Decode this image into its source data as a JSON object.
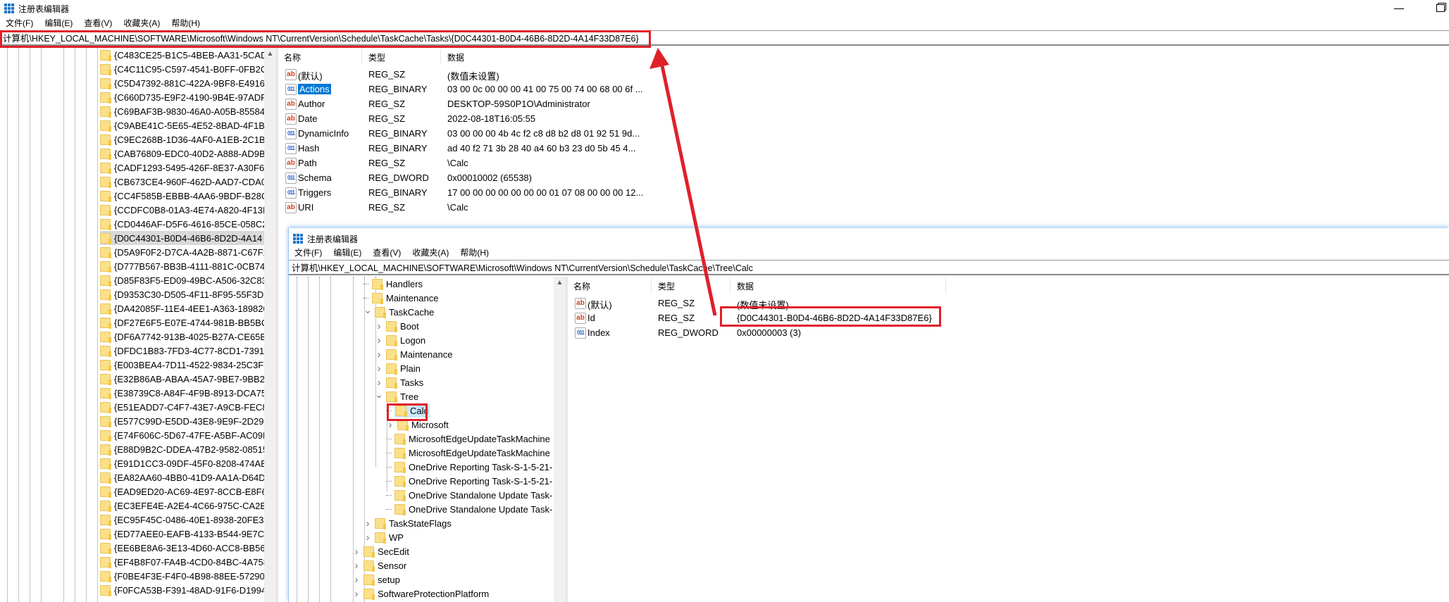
{
  "main_window": {
    "title": "注册表编辑器",
    "menu": [
      "文件(F)",
      "编辑(E)",
      "查看(V)",
      "收藏夹(A)",
      "帮助(H)"
    ],
    "address": "计算机\\HKEY_LOCAL_MACHINE\\SOFTWARE\\Microsoft\\Windows NT\\CurrentVersion\\Schedule\\TaskCache\\Tasks\\{D0C44301-B0D4-46B6-8D2D-4A14F33D87E6}",
    "tree_items": [
      "{C483CE25-B1C5-4BEB-AA31-5CAD",
      "{C4C11C95-C597-4541-B0FF-0FB2C7",
      "{C5D47392-881C-422A-9BF8-E4916",
      "{C660D735-E9F2-4190-9B4E-97ADF",
      "{C69BAF3B-9830-46A0-A05B-85584",
      "{C9ABE41C-5E65-4E52-8BAD-4F1BC",
      "{C9EC268B-1D36-4AF0-A1EB-2C1BC",
      "{CAB76809-EDC0-40D2-A888-AD9B",
      "{CADF1293-5495-426F-8E37-A30F69",
      "{CB673CE4-960F-462D-AAD7-CDA0",
      "{CC4F585B-EBBB-4AA6-9BDF-B28C",
      "{CCDFC0B8-01A3-4E74-A820-4F13F",
      "{CD0446AF-D5F6-4616-85CE-058C2",
      "{D0C44301-B0D4-46B6-8D2D-4A14",
      "{D5A9F0F2-D7CA-4A2B-8871-C67F2",
      "{D777B567-BB3B-4111-881C-0CB74",
      "{D85F83F5-ED09-49BC-A506-32C83",
      "{D9353C30-D505-4F11-8F95-55F3DI",
      "{DA42085F-11E4-4EE1-A363-189820",
      "{DF27E6F5-E07E-4744-981B-BB5BC",
      "{DF6A7742-913B-4025-B27A-CE65B",
      "{DFDC1B83-7FD3-4C77-8CD1-7391D",
      "{E003BEA4-7D11-4522-9834-25C3F",
      "{E32B86AB-ABAA-45A7-9BE7-9BB2I",
      "{E38739C8-A84F-4F9B-8913-DCA75",
      "{E51EADD7-C4F7-43E7-A9CB-FEC8E",
      "{E577C99D-E5DD-43E8-9E9F-2D291",
      "{E74F606C-5D67-47FE-A5BF-AC09E",
      "{E88D9B2C-DDEA-47B2-9582-08515",
      "{E91D1CC3-09DF-45F0-8208-474AE",
      "{EA82AA60-4BB0-41D9-AA1A-D64D",
      "{EAD9ED20-AC69-4E97-8CCB-E8F62",
      "{EC3EFE4E-A2E4-4C66-975C-CA2EFI",
      "{EC95F45C-0486-40E1-8938-20FE3E",
      "{ED77AEE0-EAFB-4133-B544-9E7C5",
      "{EE6BE8A6-3E13-4D60-ACC8-BB56D",
      "{EF4B8F07-FA4B-4CD0-84BC-4A758",
      "{F0BE4F3E-F4F0-4B98-88EE-57290D",
      "{F0FCA53B-F391-48AD-91F6-D19948"
    ],
    "selected_tree_item": "{D0C44301-B0D4-46B6-8D2D-4A14",
    "columns": [
      "名称",
      "类型",
      "数据"
    ],
    "values": [
      {
        "name": "(默认)",
        "type": "REG_SZ",
        "data": "(数值未设置)",
        "icon": "string-value-icon"
      },
      {
        "name": "Actions",
        "type": "REG_BINARY",
        "data": "03 00 0c 00 00 00 41 00 75 00 74 00 68 00 6f ...",
        "icon": "binary-value-icon",
        "selected": true
      },
      {
        "name": "Author",
        "type": "REG_SZ",
        "data": "DESKTOP-59S0P1O\\Administrator",
        "icon": "string-value-icon"
      },
      {
        "name": "Date",
        "type": "REG_SZ",
        "data": "2022-08-18T16:05:55",
        "icon": "string-value-icon"
      },
      {
        "name": "DynamicInfo",
        "type": "REG_BINARY",
        "data": "03 00 00 00 4b 4c f2 c8 d8 b2 d8 01 92 51 9d...",
        "icon": "binary-value-icon"
      },
      {
        "name": "Hash",
        "type": "REG_BINARY",
        "data": "ad 40 f2 71 3b 28 40 a4 60 b3 23 d0 5b 45 4...",
        "icon": "binary-value-icon"
      },
      {
        "name": "Path",
        "type": "REG_SZ",
        "data": "\\Calc",
        "icon": "string-value-icon"
      },
      {
        "name": "Schema",
        "type": "REG_DWORD",
        "data": "0x00010002 (65538)",
        "icon": "binary-value-icon"
      },
      {
        "name": "Triggers",
        "type": "REG_BINARY",
        "data": "17 00 00 00 00 00 00 00 01 07 08 00 00 00 12...",
        "icon": "binary-value-icon"
      },
      {
        "name": "URI",
        "type": "REG_SZ",
        "data": "\\Calc",
        "icon": "string-value-icon"
      }
    ]
  },
  "second_window": {
    "title": "注册表编辑器",
    "menu": [
      "文件(F)",
      "编辑(E)",
      "查看(V)",
      "收藏夹(A)",
      "帮助(H)"
    ],
    "address": "计算机\\HKEY_LOCAL_MACHINE\\SOFTWARE\\Microsoft\\Windows NT\\CurrentVersion\\Schedule\\TaskCache\\Tree\\Calc",
    "tree_items": [
      {
        "label": "Handlers",
        "level": 2,
        "expander": "none"
      },
      {
        "label": "Maintenance",
        "level": 2,
        "expander": "none"
      },
      {
        "label": "TaskCache",
        "level": 2,
        "expander": "expanded"
      },
      {
        "label": "Boot",
        "level": 3,
        "expander": "collapsed"
      },
      {
        "label": "Logon",
        "level": 3,
        "expander": "collapsed"
      },
      {
        "label": "Maintenance",
        "level": 3,
        "expander": "collapsed"
      },
      {
        "label": "Plain",
        "level": 3,
        "expander": "collapsed"
      },
      {
        "label": "Tasks",
        "level": 3,
        "expander": "collapsed"
      },
      {
        "label": "Tree",
        "level": 3,
        "expander": "expanded"
      },
      {
        "label": "Calc",
        "level": 4,
        "expander": "none",
        "selected": true
      },
      {
        "label": "Microsoft",
        "level": 4,
        "expander": "collapsed"
      },
      {
        "label": "MicrosoftEdgeUpdateTaskMachine",
        "level": 4,
        "expander": "none"
      },
      {
        "label": "MicrosoftEdgeUpdateTaskMachine",
        "level": 4,
        "expander": "none"
      },
      {
        "label": "OneDrive Reporting Task-S-1-5-21-",
        "level": 4,
        "expander": "none"
      },
      {
        "label": "OneDrive Reporting Task-S-1-5-21-",
        "level": 4,
        "expander": "none"
      },
      {
        "label": "OneDrive Standalone Update Task-",
        "level": 4,
        "expander": "none"
      },
      {
        "label": "OneDrive Standalone Update Task-",
        "level": 4,
        "expander": "none"
      },
      {
        "label": "TaskStateFlags",
        "level": 2,
        "expander": "collapsed"
      },
      {
        "label": "WP",
        "level": 2,
        "expander": "collapsed"
      },
      {
        "label": "SecEdit",
        "level": 1,
        "expander": "collapsed"
      },
      {
        "label": "Sensor",
        "level": 1,
        "expander": "collapsed"
      },
      {
        "label": "setup",
        "level": 1,
        "expander": "collapsed"
      },
      {
        "label": "SoftwareProtectionPlatform",
        "level": 1,
        "expander": "collapsed"
      }
    ],
    "columns": [
      "名称",
      "类型",
      "数据"
    ],
    "values": [
      {
        "name": "(默认)",
        "type": "REG_SZ",
        "data": "(数值未设置)",
        "icon": "string-value-icon"
      },
      {
        "name": "Id",
        "type": "REG_SZ",
        "data": "{D0C44301-B0D4-46B6-8D2D-4A14F33D87E6}",
        "icon": "string-value-icon",
        "highlighted": true
      },
      {
        "name": "Index",
        "type": "REG_DWORD",
        "data": "0x00000003 (3)",
        "icon": "binary-value-icon"
      }
    ]
  },
  "annotations": {
    "highlight_color": "#e0202a",
    "arrow": "from Id value to main address bar"
  },
  "colors": {
    "selection": "#0078d7",
    "folder": "#fbe08a",
    "tree_selected_bg": "#cce8ff"
  }
}
